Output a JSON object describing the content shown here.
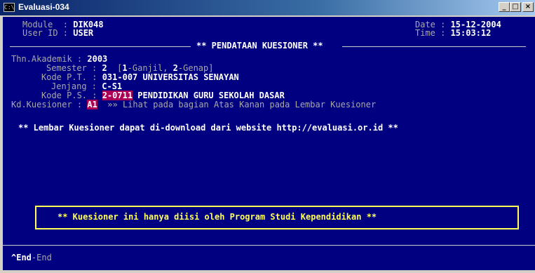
{
  "window": {
    "title": "Evaluasi-034",
    "icon_text": "C:\\",
    "minimize_glyph": "_",
    "maximize_glyph": "□",
    "close_glyph": "×"
  },
  "header": {
    "module_label": "Module  : ",
    "module_value": "DIK048",
    "user_label": "User ID : ",
    "user_value": "USER",
    "date_label": "Date : ",
    "date_value": "15-12-2004",
    "time_label": "Time : ",
    "time_value": "15:03:12",
    "screen_title": "** PENDATAAN KUESIONER **"
  },
  "form": {
    "thn_label": "Thn.Akademik : ",
    "thn_value": "2003",
    "semester_label": "Semester : ",
    "semester_value": "2",
    "semester_hint_1": "[",
    "semester_hint_2": "1",
    "semester_hint_3": "-Ganjil, ",
    "semester_hint_4": "2",
    "semester_hint_5": "-Genap]",
    "kode_pt_label": "Kode P.T. : ",
    "kode_pt_value": "031-007 UNIVERSITAS SENAYAN",
    "jenjang_label": "Jenjang : ",
    "jenjang_value": "C-S1",
    "kode_ps_label": "Kode P.S. : ",
    "kode_ps_code": "2-0711",
    "kode_ps_name": " PENDIDIKAN GURU SEKOLAH DASAR",
    "kd_kuesioner_label": "Kd.Kuesioner : ",
    "kd_kuesioner_value": "A1",
    "kd_kuesioner_hint": "»» Lihat pada bagian Atas Kanan pada Lembar Kuesioner"
  },
  "info_line": "** Lembar Kuesioner dapat di-download dari website http://evaluasi.or.id **",
  "notice": "** Kuesioner ini hanya diisi oleh Program Studi Kependidikan **",
  "footer": {
    "key": "^End",
    "action": "-End"
  }
}
